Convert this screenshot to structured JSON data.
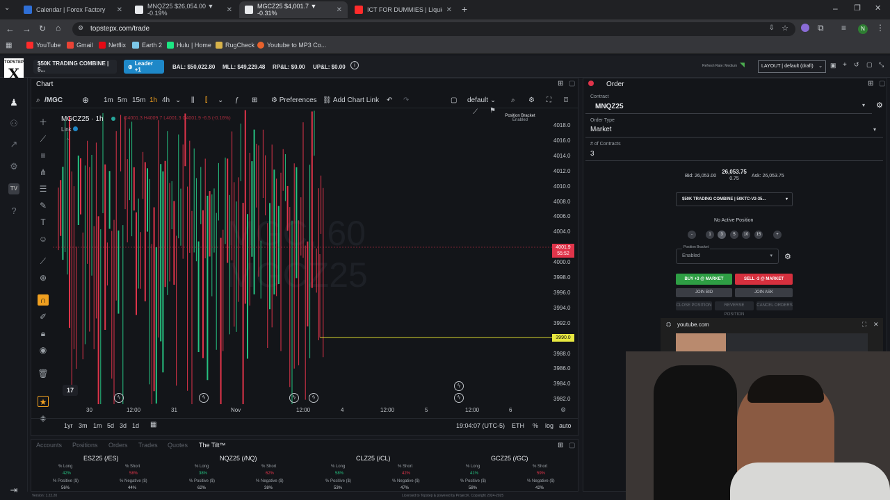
{
  "browser": {
    "tabs": [
      {
        "title": "Calendar | Forex Factory",
        "color": "#2f6fd6",
        "active": false
      },
      {
        "title": "MNQZ25 $26,054.00 ▼ -0.19%",
        "color": "#e8eaed",
        "active": false
      },
      {
        "title": "MGCZ25 $4,001.7 ▼ -0.31%",
        "color": "#e8eaed",
        "active": true
      },
      {
        "title": "ICT FOR DUMMIES | Liquidi...",
        "color": "#ff2b2b",
        "active": false
      }
    ],
    "url": "topstepx.com/trade",
    "bookmarks": [
      {
        "label": "YouTube",
        "color": "#ff2b2b"
      },
      {
        "label": "Gmail",
        "color": "#ea4335"
      },
      {
        "label": "Netflix",
        "color": "#e50914"
      },
      {
        "label": "Earth 2",
        "color": "#7cc7e8"
      },
      {
        "label": "Hulu | Home",
        "color": "#1ce783"
      },
      {
        "label": "RugCheck",
        "color": "#d8b34a"
      },
      {
        "label": "Youtube to MP3 Co...",
        "color": "#e8622c"
      }
    ]
  },
  "header": {
    "logo_top": "TOPSTEP",
    "logo_letter": "X",
    "account": "$50K TRADING COMBINE | 5...",
    "leader": "Leader +1",
    "bal": "BAL: $50,022.80",
    "mll": "MLL: $49,229.48",
    "rpl": "RP&L: $0.00",
    "upl": "UP&L: $0.00",
    "refresh": "Refresh Rate: Medium",
    "layout": "LAYOUT | default (draft)"
  },
  "chart": {
    "panel_title": "Chart",
    "symbol": "/MGC",
    "timeframes": [
      "1m",
      "5m",
      "15m",
      "1h",
      "4h"
    ],
    "active_timeframe": "1h",
    "preferences": "Preferences",
    "add_link": "Add Chart Link",
    "template": "default",
    "legend_symbol": "MGCZ25 · 1h",
    "legend_ohlc": "O4001.3 H4009.7 L4001.3 C4001.9 -6.5 (-0.16%)",
    "link": "Link",
    "watermark1": "MGC, 60",
    "watermark2": "MGCZ25",
    "position_bracket": "Position Bracket",
    "position_bracket_state": "Enabled",
    "y_ticks": [
      "4018.0",
      "4016.0",
      "4014.0",
      "4012.0",
      "4010.0",
      "4008.0",
      "4006.0",
      "4004.0",
      "4002.0",
      "4000.0",
      "3998.0",
      "3996.0",
      "3994.0",
      "3992.0",
      "3990.0",
      "3988.0",
      "3986.0",
      "3984.0",
      "3982.0"
    ],
    "last_price": "4001.9",
    "last_timer": "55:52",
    "order_line_price": "3990.0",
    "x_ticks": [
      "30",
      "12:00",
      "31",
      "Nov",
      "12:00",
      "4",
      "12:00",
      "5",
      "12:00",
      "6"
    ],
    "ranges": [
      "1yr",
      "3m",
      "1m",
      "5d",
      "3d",
      "1d"
    ],
    "clock": "19:04:07 (UTC-5)",
    "session": "ETH",
    "pct": "%",
    "log": "log",
    "auto": "auto",
    "tv": "TV"
  },
  "chart_data": {
    "type": "candlestick",
    "title": "MGCZ25 · 1h",
    "ylim": [
      3981,
      4019
    ],
    "last_price": 4001.9,
    "order_line": 3990.0
  },
  "bottom": {
    "tabs": [
      "Accounts",
      "Positions",
      "Orders",
      "Trades",
      "Quotes",
      "The Tilt™"
    ],
    "active_tab": "The Tilt™",
    "instruments": [
      {
        "name": "ESZ25 (/ES)",
        "long": "42%",
        "short": "58%",
        "pos": "56%",
        "neg": "44%"
      },
      {
        "name": "NQZ25 (/NQ)",
        "long": "38%",
        "short": "62%",
        "pos": "62%",
        "neg": "38%"
      },
      {
        "name": "CLZ25 (/CL)",
        "long": "58%",
        "short": "42%",
        "pos": "53%",
        "neg": "47%"
      },
      {
        "name": "GCZ25 (/GC)",
        "long": "41%",
        "short": "59%",
        "pos": "58%",
        "neg": "42%"
      }
    ],
    "labels": {
      "long": "% Long",
      "short": "% Short",
      "pos": "% Positive ($)",
      "neg": "% Negative ($)"
    },
    "version": "Version: 1.22.20",
    "license": "Licensed to Topstep & powered by ProjectX. Copyright 2024-2025"
  },
  "order": {
    "title": "Order",
    "contract_label": "Contract",
    "contract": "MNQZ25",
    "order_type_label": "Order Type",
    "order_type": "Market",
    "contracts_label": "# of Contracts",
    "contracts": "3",
    "bid": "Bid: 26,053.00",
    "mid": "26,053.75",
    "spread": "0.75",
    "ask": "Ask: 26,053.75",
    "account": "$50K TRADING COMBINE | 50KTC-V2-35...",
    "no_position": "No Active Position",
    "qty_buttons": [
      "-",
      "1",
      "3",
      "5",
      "10",
      "15",
      "+"
    ],
    "bracket_label": "Position Bracket",
    "bracket_value": "Enabled",
    "buy": "BUY +3 @ MARKET",
    "sell": "SELL -3 @ MARKET",
    "join_bid": "JOIN BID",
    "join_ask": "JOIN ASK",
    "close_position": "CLOSE POSITION",
    "reverse_position": "REVERSE POSITION",
    "cancel_orders": "CANCEL ORDERS"
  },
  "popup": {
    "site": "youtube.com"
  }
}
